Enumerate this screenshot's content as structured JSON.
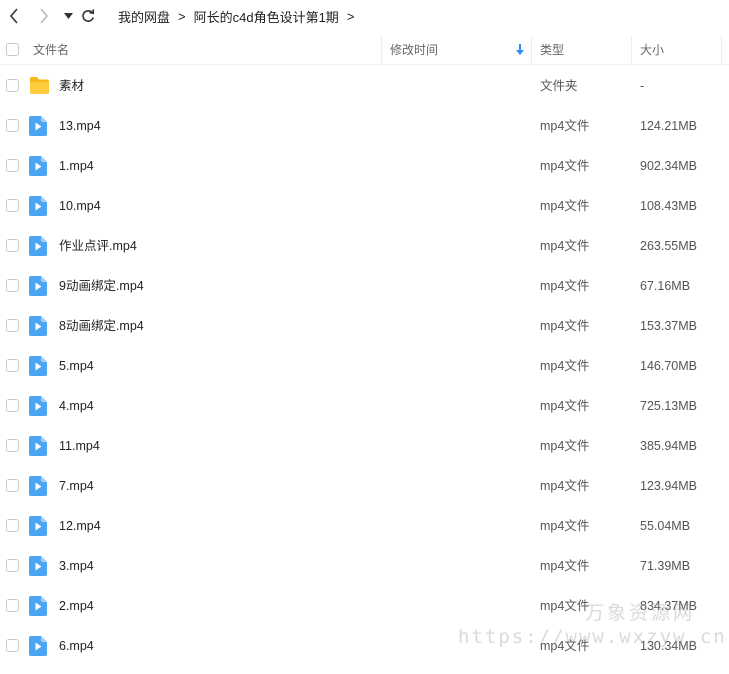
{
  "nav": {
    "breadcrumb": [
      "我的网盘",
      "阿长的c4d角色设计第1期"
    ]
  },
  "header": {
    "name": "文件名",
    "modified": "修改时间",
    "type": "类型",
    "size": "大小"
  },
  "files": [
    {
      "name": "素材",
      "type": "文件夹",
      "size": "-",
      "icon": "folder-icon"
    },
    {
      "name": "13.mp4",
      "type": "mp4文件",
      "size": "124.21MB",
      "icon": "video-file-icon"
    },
    {
      "name": "1.mp4",
      "type": "mp4文件",
      "size": "902.34MB",
      "icon": "video-file-icon"
    },
    {
      "name": "10.mp4",
      "type": "mp4文件",
      "size": "108.43MB",
      "icon": "video-file-icon"
    },
    {
      "name": "作业点评.mp4",
      "type": "mp4文件",
      "size": "263.55MB",
      "icon": "video-file-icon"
    },
    {
      "name": "9动画绑定.mp4",
      "type": "mp4文件",
      "size": "67.16MB",
      "icon": "video-file-icon"
    },
    {
      "name": "8动画绑定.mp4",
      "type": "mp4文件",
      "size": "153.37MB",
      "icon": "video-file-icon"
    },
    {
      "name": "5.mp4",
      "type": "mp4文件",
      "size": "146.70MB",
      "icon": "video-file-icon"
    },
    {
      "name": "4.mp4",
      "type": "mp4文件",
      "size": "725.13MB",
      "icon": "video-file-icon"
    },
    {
      "name": "11.mp4",
      "type": "mp4文件",
      "size": "385.94MB",
      "icon": "video-file-icon"
    },
    {
      "name": "7.mp4",
      "type": "mp4文件",
      "size": "123.94MB",
      "icon": "video-file-icon"
    },
    {
      "name": "12.mp4",
      "type": "mp4文件",
      "size": "55.04MB",
      "icon": "video-file-icon"
    },
    {
      "name": "3.mp4",
      "type": "mp4文件",
      "size": "71.39MB",
      "icon": "video-file-icon"
    },
    {
      "name": "2.mp4",
      "type": "mp4文件",
      "size": "834.37MB",
      "icon": "video-file-icon"
    },
    {
      "name": "6.mp4",
      "type": "mp4文件",
      "size": "130.34MB",
      "icon": "video-file-icon"
    }
  ],
  "watermark": {
    "cn": "万象资源网",
    "url": "https://www.wxzyw.cn"
  },
  "colors": {
    "accent": "#2f8ff0",
    "folder": "#f8c32e",
    "video_icon": "#4aa6f0"
  }
}
